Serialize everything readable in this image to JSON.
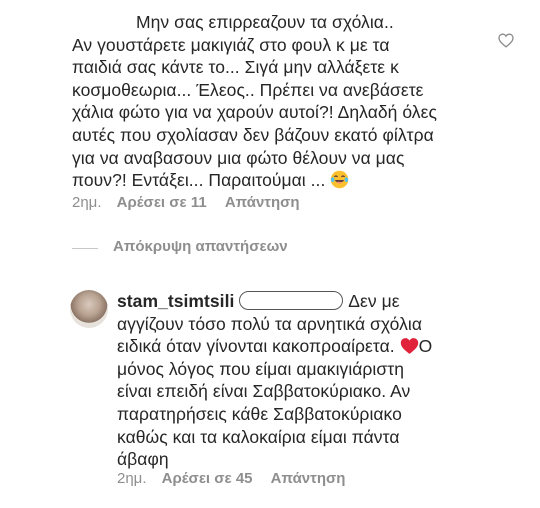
{
  "comment1": {
    "lines": [
      "Μην σας επιρρεαζουν τα σχόλια..",
      "Αν γουστάρετε μακιγιάζ στο φουλ κ με τα",
      "παιδιά σας κάντε το... Σιγά μην αλλάξετε κ",
      "κοσμοθεωρια... Έλεος.. Πρέπει να ανεβάσετε",
      "χάλια φώτο για να χαρούν αυτοί?! Δηλαδή όλες",
      "αυτές που σχολίασαν δεν βάζουν εκατό φίλτρα",
      "για να αναβασουν μια φώτο θέλουν να μας",
      "πουν?! Εντάξει... Παραιτούμαι ..."
    ],
    "emoji": "face-with-tears-of-joy",
    "time": "2ημ.",
    "likes": "Αρέσει σε 11",
    "reply": "Απάντηση"
  },
  "hide_replies": "Απόκρυψη απαντήσεων",
  "reply1": {
    "username": "stam_tsimtsili",
    "line1_after_mention": "Δεν με",
    "lines": [
      "αγγίζουν τόσο πολύ τα αρνητικά σχόλια",
      "ειδικά όταν γίνονται κακοπροαίρετα.",
      "μόνος λόγος που είμαι αμακιγιάριστη",
      "είναι επειδή είναι Σαββατοκύριακο. Αν",
      "παρατηρήσεις κάθε Σαββατοκύριακο",
      "καθώς και τα καλοκαίρια είμαι πάντα",
      "άβαφη"
    ],
    "heart_text_after": "Ο",
    "emoji": "red-heart",
    "time": "2ημ.",
    "likes": "Αρέσει σε 45",
    "reply": "Απάντηση"
  },
  "colors": {
    "text": "#262626",
    "meta": "#8e8e8e",
    "heart_emoji": "#e0223a"
  }
}
